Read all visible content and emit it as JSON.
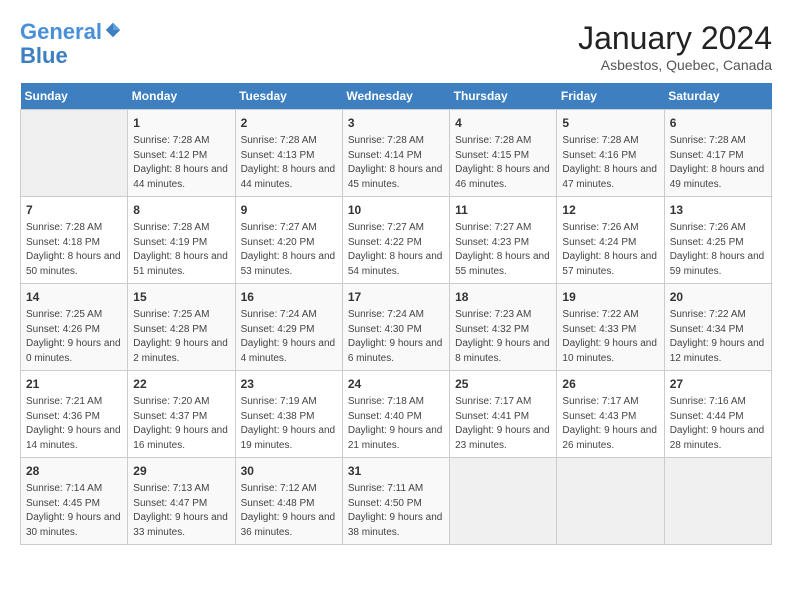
{
  "header": {
    "logo_line1": "General",
    "logo_line2": "Blue",
    "month_title": "January 2024",
    "location": "Asbestos, Quebec, Canada"
  },
  "days_of_week": [
    "Sunday",
    "Monday",
    "Tuesday",
    "Wednesday",
    "Thursday",
    "Friday",
    "Saturday"
  ],
  "weeks": [
    [
      {
        "day": "",
        "sunrise": "",
        "sunset": "",
        "daylight": ""
      },
      {
        "day": "1",
        "sunrise": "Sunrise: 7:28 AM",
        "sunset": "Sunset: 4:12 PM",
        "daylight": "Daylight: 8 hours and 44 minutes."
      },
      {
        "day": "2",
        "sunrise": "Sunrise: 7:28 AM",
        "sunset": "Sunset: 4:13 PM",
        "daylight": "Daylight: 8 hours and 44 minutes."
      },
      {
        "day": "3",
        "sunrise": "Sunrise: 7:28 AM",
        "sunset": "Sunset: 4:14 PM",
        "daylight": "Daylight: 8 hours and 45 minutes."
      },
      {
        "day": "4",
        "sunrise": "Sunrise: 7:28 AM",
        "sunset": "Sunset: 4:15 PM",
        "daylight": "Daylight: 8 hours and 46 minutes."
      },
      {
        "day": "5",
        "sunrise": "Sunrise: 7:28 AM",
        "sunset": "Sunset: 4:16 PM",
        "daylight": "Daylight: 8 hours and 47 minutes."
      },
      {
        "day": "6",
        "sunrise": "Sunrise: 7:28 AM",
        "sunset": "Sunset: 4:17 PM",
        "daylight": "Daylight: 8 hours and 49 minutes."
      }
    ],
    [
      {
        "day": "7",
        "sunrise": "Sunrise: 7:28 AM",
        "sunset": "Sunset: 4:18 PM",
        "daylight": "Daylight: 8 hours and 50 minutes."
      },
      {
        "day": "8",
        "sunrise": "Sunrise: 7:28 AM",
        "sunset": "Sunset: 4:19 PM",
        "daylight": "Daylight: 8 hours and 51 minutes."
      },
      {
        "day": "9",
        "sunrise": "Sunrise: 7:27 AM",
        "sunset": "Sunset: 4:20 PM",
        "daylight": "Daylight: 8 hours and 53 minutes."
      },
      {
        "day": "10",
        "sunrise": "Sunrise: 7:27 AM",
        "sunset": "Sunset: 4:22 PM",
        "daylight": "Daylight: 8 hours and 54 minutes."
      },
      {
        "day": "11",
        "sunrise": "Sunrise: 7:27 AM",
        "sunset": "Sunset: 4:23 PM",
        "daylight": "Daylight: 8 hours and 55 minutes."
      },
      {
        "day": "12",
        "sunrise": "Sunrise: 7:26 AM",
        "sunset": "Sunset: 4:24 PM",
        "daylight": "Daylight: 8 hours and 57 minutes."
      },
      {
        "day": "13",
        "sunrise": "Sunrise: 7:26 AM",
        "sunset": "Sunset: 4:25 PM",
        "daylight": "Daylight: 8 hours and 59 minutes."
      }
    ],
    [
      {
        "day": "14",
        "sunrise": "Sunrise: 7:25 AM",
        "sunset": "Sunset: 4:26 PM",
        "daylight": "Daylight: 9 hours and 0 minutes."
      },
      {
        "day": "15",
        "sunrise": "Sunrise: 7:25 AM",
        "sunset": "Sunset: 4:28 PM",
        "daylight": "Daylight: 9 hours and 2 minutes."
      },
      {
        "day": "16",
        "sunrise": "Sunrise: 7:24 AM",
        "sunset": "Sunset: 4:29 PM",
        "daylight": "Daylight: 9 hours and 4 minutes."
      },
      {
        "day": "17",
        "sunrise": "Sunrise: 7:24 AM",
        "sunset": "Sunset: 4:30 PM",
        "daylight": "Daylight: 9 hours and 6 minutes."
      },
      {
        "day": "18",
        "sunrise": "Sunrise: 7:23 AM",
        "sunset": "Sunset: 4:32 PM",
        "daylight": "Daylight: 9 hours and 8 minutes."
      },
      {
        "day": "19",
        "sunrise": "Sunrise: 7:22 AM",
        "sunset": "Sunset: 4:33 PM",
        "daylight": "Daylight: 9 hours and 10 minutes."
      },
      {
        "day": "20",
        "sunrise": "Sunrise: 7:22 AM",
        "sunset": "Sunset: 4:34 PM",
        "daylight": "Daylight: 9 hours and 12 minutes."
      }
    ],
    [
      {
        "day": "21",
        "sunrise": "Sunrise: 7:21 AM",
        "sunset": "Sunset: 4:36 PM",
        "daylight": "Daylight: 9 hours and 14 minutes."
      },
      {
        "day": "22",
        "sunrise": "Sunrise: 7:20 AM",
        "sunset": "Sunset: 4:37 PM",
        "daylight": "Daylight: 9 hours and 16 minutes."
      },
      {
        "day": "23",
        "sunrise": "Sunrise: 7:19 AM",
        "sunset": "Sunset: 4:38 PM",
        "daylight": "Daylight: 9 hours and 19 minutes."
      },
      {
        "day": "24",
        "sunrise": "Sunrise: 7:18 AM",
        "sunset": "Sunset: 4:40 PM",
        "daylight": "Daylight: 9 hours and 21 minutes."
      },
      {
        "day": "25",
        "sunrise": "Sunrise: 7:17 AM",
        "sunset": "Sunset: 4:41 PM",
        "daylight": "Daylight: 9 hours and 23 minutes."
      },
      {
        "day": "26",
        "sunrise": "Sunrise: 7:17 AM",
        "sunset": "Sunset: 4:43 PM",
        "daylight": "Daylight: 9 hours and 26 minutes."
      },
      {
        "day": "27",
        "sunrise": "Sunrise: 7:16 AM",
        "sunset": "Sunset: 4:44 PM",
        "daylight": "Daylight: 9 hours and 28 minutes."
      }
    ],
    [
      {
        "day": "28",
        "sunrise": "Sunrise: 7:14 AM",
        "sunset": "Sunset: 4:45 PM",
        "daylight": "Daylight: 9 hours and 30 minutes."
      },
      {
        "day": "29",
        "sunrise": "Sunrise: 7:13 AM",
        "sunset": "Sunset: 4:47 PM",
        "daylight": "Daylight: 9 hours and 33 minutes."
      },
      {
        "day": "30",
        "sunrise": "Sunrise: 7:12 AM",
        "sunset": "Sunset: 4:48 PM",
        "daylight": "Daylight: 9 hours and 36 minutes."
      },
      {
        "day": "31",
        "sunrise": "Sunrise: 7:11 AM",
        "sunset": "Sunset: 4:50 PM",
        "daylight": "Daylight: 9 hours and 38 minutes."
      },
      {
        "day": "",
        "sunrise": "",
        "sunset": "",
        "daylight": ""
      },
      {
        "day": "",
        "sunrise": "",
        "sunset": "",
        "daylight": ""
      },
      {
        "day": "",
        "sunrise": "",
        "sunset": "",
        "daylight": ""
      }
    ]
  ]
}
